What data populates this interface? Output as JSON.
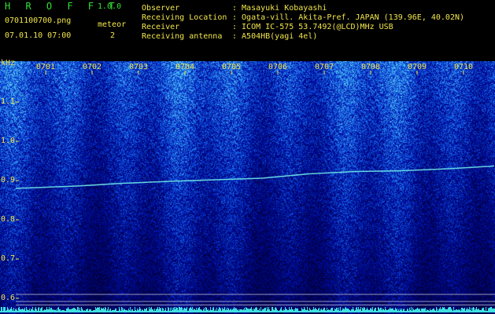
{
  "header": {
    "app_title": "H R O F F T",
    "app_version": "1.0.0",
    "filename": "0701100700.png",
    "datetime": "07.01.10 07:00",
    "meteor_label": "meteor",
    "meteor_count": "2",
    "info": [
      {
        "label": "Observer",
        "value": ": Masayuki Kobayashi"
      },
      {
        "label": "Receiving Location",
        "value": ": Ogata-vill. Akita-Pref. JAPAN (139.96E, 40.02N)"
      },
      {
        "label": "Receiver",
        "value": ": ICOM IC-575 53.7492(@LCD)MHz USB"
      },
      {
        "label": "Receiving antenna",
        "value": ": A504HB(yagi 4el)"
      }
    ]
  },
  "colors": {
    "text": "#f2e64a",
    "title": "#35e035",
    "background": "#000000",
    "spectrum_low": "#06087a",
    "spectrum_mid": "#1a40d8",
    "spectrum_high": "#3fe0e0",
    "trace": "#6fe8e8",
    "lines": "#c8c8e0"
  },
  "chart_data": {
    "type": "heatmap",
    "title": "",
    "xlabel": "",
    "ylabel": "kHz",
    "x_ticks": [
      "0701",
      "0702",
      "0703",
      "0704",
      "0705",
      "0706",
      "0707",
      "0708",
      "0709",
      "0710"
    ],
    "y_ticks": [
      1.1,
      1.0,
      0.9,
      0.8,
      0.7,
      0.6
    ],
    "ylim": [
      0.57,
      1.17
    ],
    "xlim_minutes": [
      0,
      10
    ],
    "carrier_trace": {
      "x_minutes": [
        0,
        1,
        2,
        3,
        4,
        5,
        6,
        7,
        8,
        9,
        10
      ],
      "khz": [
        0.88,
        0.886,
        0.893,
        0.898,
        0.902,
        0.906,
        0.917,
        0.923,
        0.925,
        0.93,
        0.937
      ]
    },
    "horizontal_lines_khz": [
      0.61,
      0.592,
      0.583
    ],
    "meteor_count": 2
  }
}
